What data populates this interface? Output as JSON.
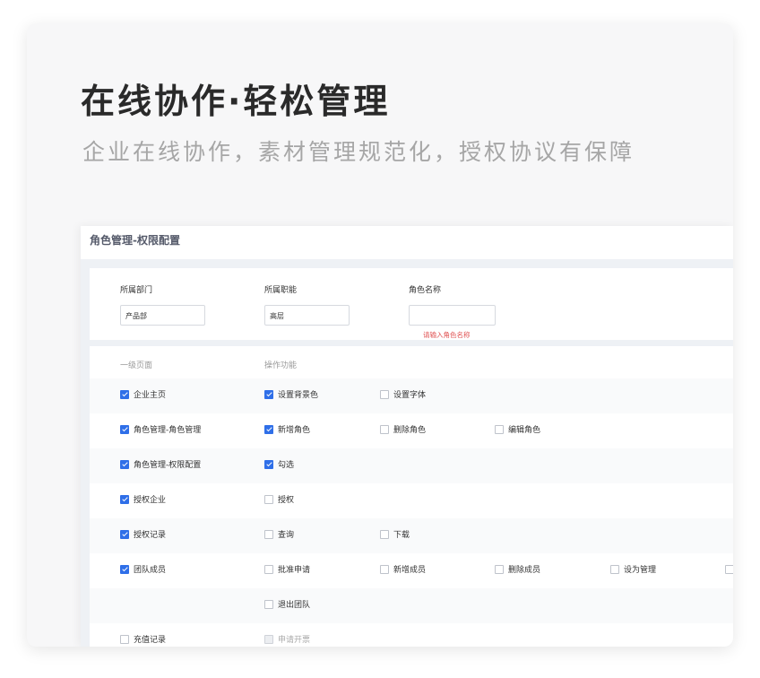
{
  "hero": {
    "title": "在线协作·轻松管理",
    "subtitle": "企业在线协作，素材管理规范化，授权协议有保障"
  },
  "panel": {
    "title": "角色管理-权限配置"
  },
  "filters": {
    "department": {
      "label": "所属部门",
      "value": "产品部"
    },
    "position": {
      "label": "所属职能",
      "value": "高层"
    },
    "role_name": {
      "label": "角色名称",
      "value": "",
      "error": "请输入角色名称"
    }
  },
  "permissions": {
    "col_page": "一级页面",
    "col_ops": "操作功能",
    "rows": [
      {
        "page": {
          "label": "企业主页",
          "checked": true
        },
        "ops": [
          {
            "label": "设置背景色",
            "checked": true
          },
          {
            "label": "设置字体",
            "checked": false
          }
        ]
      },
      {
        "page": {
          "label": "角色管理-角色管理",
          "checked": true
        },
        "ops": [
          {
            "label": "新增角色",
            "checked": true
          },
          {
            "label": "删除角色",
            "checked": false
          },
          {
            "label": "编辑角色",
            "checked": false
          }
        ]
      },
      {
        "page": {
          "label": "角色管理-权限配置",
          "checked": true
        },
        "ops": [
          {
            "label": "勾选",
            "checked": true
          }
        ]
      },
      {
        "page": {
          "label": "授权企业",
          "checked": true
        },
        "ops": [
          {
            "label": "授权",
            "checked": false
          }
        ]
      },
      {
        "page": {
          "label": "授权记录",
          "checked": true
        },
        "ops": [
          {
            "label": "查询",
            "checked": false
          },
          {
            "label": "下载",
            "checked": false
          }
        ]
      },
      {
        "page": {
          "label": "团队成员",
          "checked": true
        },
        "ops": [
          {
            "label": "批准申请",
            "checked": false
          },
          {
            "label": "新增成员",
            "checked": false
          },
          {
            "label": "删除成员",
            "checked": false
          },
          {
            "label": "设为管理",
            "checked": false
          },
          {
            "label": "",
            "checked": false
          }
        ]
      },
      {
        "page": null,
        "ops": [
          {
            "label": "退出团队",
            "checked": false
          }
        ]
      },
      {
        "page": {
          "label": "充值记录",
          "checked": false
        },
        "ops": [
          {
            "label": "申请开票",
            "checked": false,
            "disabled": true
          }
        ]
      }
    ]
  },
  "colors": {
    "accent": "#2f6fe8",
    "error": "#e05252"
  }
}
